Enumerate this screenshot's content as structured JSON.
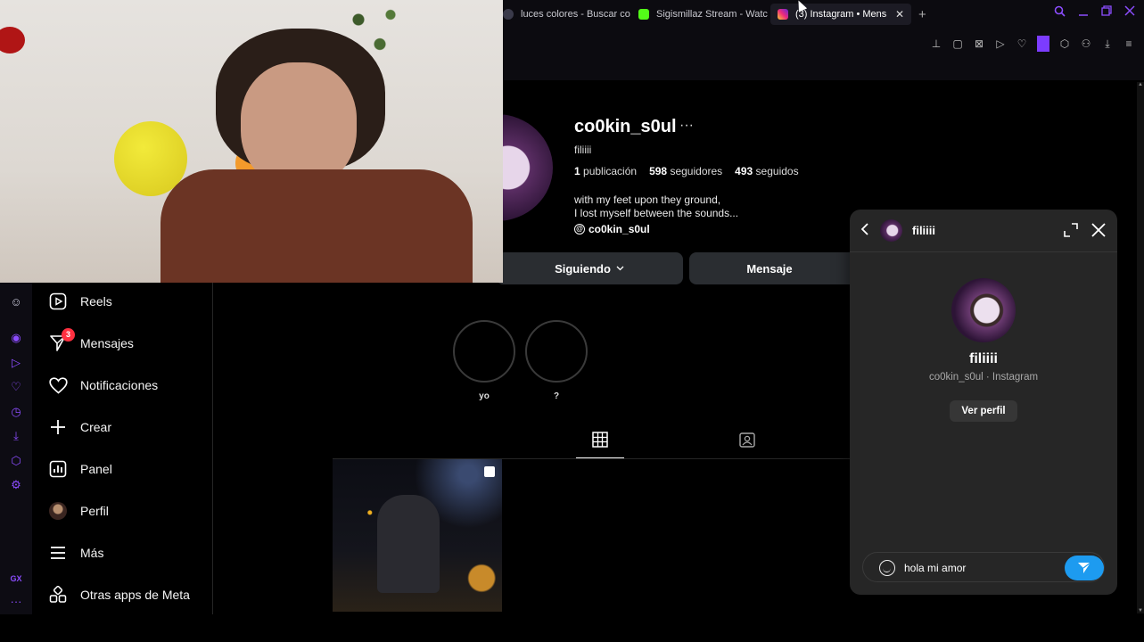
{
  "browser": {
    "tabs": [
      {
        "title": "luces colores - Buscar co",
        "favicon_color": "#3a3a4a",
        "active": false
      },
      {
        "title": "Sigismillaz Stream - Watc",
        "favicon_color": "#53fc18",
        "active": false
      },
      {
        "title": "(3) Instagram • Mens",
        "favicon_color": "#e1306c",
        "active": true
      }
    ],
    "tab_close": "✕",
    "new_tab": "+",
    "accent_color": "#8c4dff"
  },
  "profile": {
    "username": "co0kin_s0ul",
    "more": "···",
    "full_name": "filiiii",
    "stats": {
      "posts_count": "1",
      "posts_label": "publicación",
      "followers_count": "598",
      "followers_label": "seguidores",
      "following_count": "493",
      "following_label": "seguidos"
    },
    "bio_line1": "with my feet upon they ground,",
    "bio_line2": "I lost myself between the sounds...",
    "threads_handle": "co0kin_s0ul",
    "following_button": "Siguiendo",
    "message_button": "Mensaje",
    "highlights": [
      {
        "label": "yo"
      },
      {
        "label": "?"
      }
    ]
  },
  "sidebar": {
    "items": [
      {
        "label": "Reels",
        "icon": "reels-icon"
      },
      {
        "label": "Mensajes",
        "icon": "messenger-icon",
        "badge": "3"
      },
      {
        "label": "Notificaciones",
        "icon": "heart-icon"
      },
      {
        "label": "Crear",
        "icon": "plus-icon"
      },
      {
        "label": "Panel",
        "icon": "dashboard-icon"
      },
      {
        "label": "Perfil",
        "icon": "avatar"
      },
      {
        "label": "Más",
        "icon": "menu-icon"
      },
      {
        "label": "Otras apps de Meta",
        "icon": "meta-apps-icon"
      }
    ],
    "rail_gx": "GX",
    "rail_more": "···"
  },
  "chat": {
    "header_name": "filiiii",
    "name": "filiiii",
    "subtitle": "co0kin_s0ul · Instagram",
    "view_profile": "Ver perfil",
    "message_draft": "hola mi amor",
    "send_color": "#1d9bf0"
  }
}
